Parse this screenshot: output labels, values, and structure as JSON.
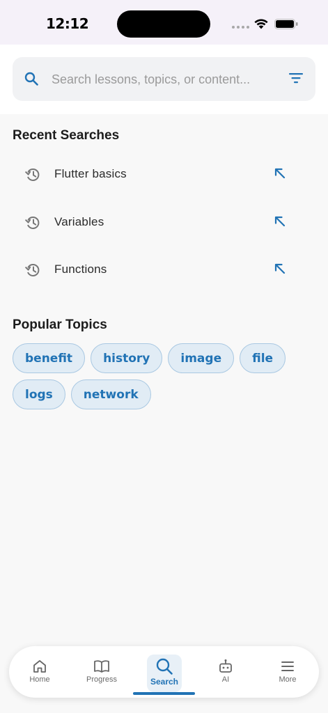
{
  "status_bar": {
    "time": "12:12"
  },
  "search": {
    "placeholder": "Search lessons, topics, or content..."
  },
  "recent": {
    "title": "Recent Searches",
    "items": [
      {
        "label": "Flutter basics"
      },
      {
        "label": "Variables"
      },
      {
        "label": "Functions"
      }
    ]
  },
  "popular": {
    "title": "Popular Topics",
    "chips": [
      "benefit",
      "history",
      "image",
      "file",
      "logs",
      "network"
    ]
  },
  "nav": {
    "items": [
      {
        "label": "Home",
        "icon": "home-icon"
      },
      {
        "label": "Progress",
        "icon": "book-icon"
      },
      {
        "label": "Search",
        "icon": "search-icon"
      },
      {
        "label": "AI",
        "icon": "robot-icon"
      },
      {
        "label": "More",
        "icon": "menu-icon"
      }
    ],
    "active": "Search"
  },
  "colors": {
    "accent": "#2173b5",
    "chip_bg": "#e1ecf5",
    "chip_border": "#a9c8e2",
    "status_bar_bg": "#f5f1f9"
  }
}
